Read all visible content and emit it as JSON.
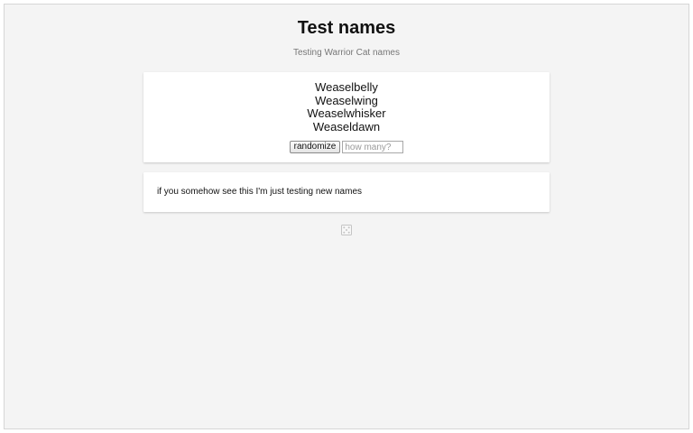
{
  "page": {
    "title": "Test names",
    "subtitle": "Testing Warrior Cat names"
  },
  "names": [
    "Weaselbelly",
    "Weaselwing",
    "Weaselwhisker",
    "Weaseldawn"
  ],
  "controls": {
    "randomize_label": "randomize",
    "count_placeholder": "how many?",
    "count_value": ""
  },
  "note": {
    "text": "if you somehow see this I'm just testing new names"
  },
  "icons": {
    "footer": "dice-icon"
  }
}
